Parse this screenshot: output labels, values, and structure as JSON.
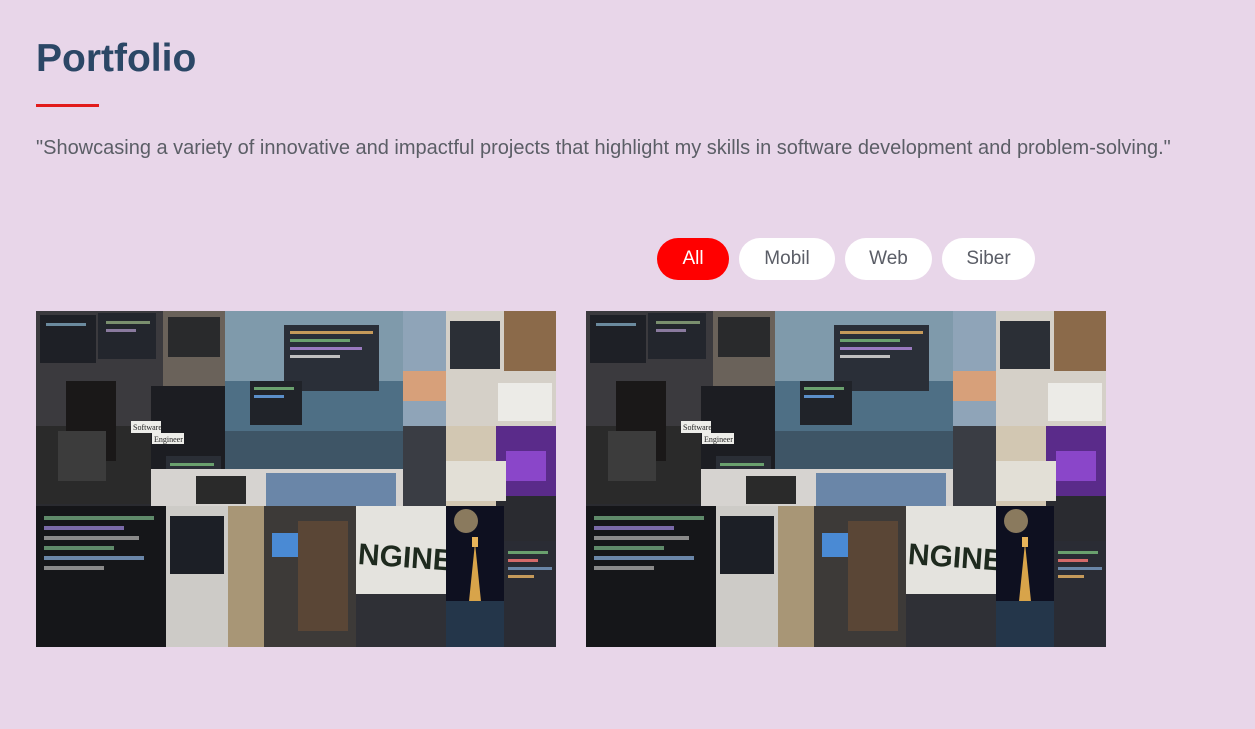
{
  "portfolio": {
    "title": "Portfolio",
    "subtitle": "\"Showcasing a variety of innovative and impactful projects that highlight my skills in software development and problem-solving.\"",
    "accent_color": "#e21b1b",
    "title_color": "#2b4766",
    "background": "#e8d6e9"
  },
  "filters": [
    {
      "label": "All",
      "active": true
    },
    {
      "label": "Mobil",
      "active": false
    },
    {
      "label": "Web",
      "active": false
    },
    {
      "label": "Siber",
      "active": false
    }
  ],
  "active_filter_color": "#ff0000",
  "projects": [
    {
      "image": {
        "alt_icon": "photo-collage",
        "texts": [
          "Software",
          "Engineer",
          "NGINEER"
        ]
      }
    },
    {
      "image": {
        "alt_icon": "photo-collage",
        "texts": [
          "Software",
          "Engineer",
          "NGINEER"
        ]
      }
    }
  ]
}
